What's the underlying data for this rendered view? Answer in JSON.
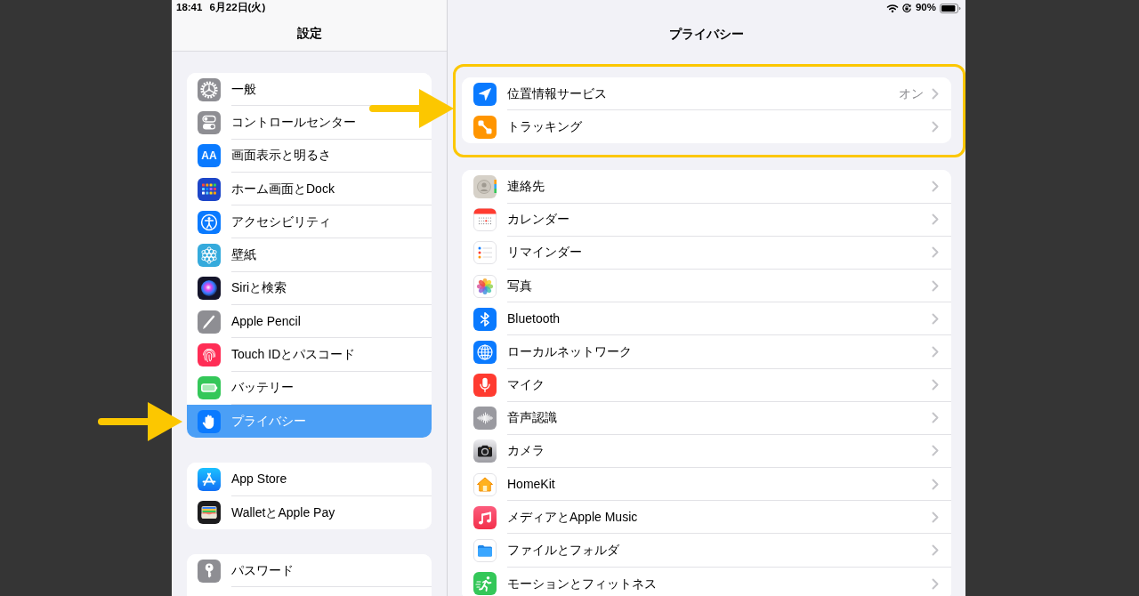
{
  "status_bar": {
    "time": "18:41",
    "date": "6月22日(火)",
    "battery": "90%"
  },
  "sidebar": {
    "title": "設定",
    "groups": [
      {
        "cut_off": false,
        "items": [
          {
            "label": "一般",
            "selected": false
          },
          {
            "label": "コントロールセンター",
            "selected": false
          },
          {
            "label": "画面表示と明るさ",
            "icon_text": "AA",
            "selected": false
          },
          {
            "label": "ホーム画面とDock",
            "selected": false
          },
          {
            "label": "アクセシビリティ",
            "selected": false
          },
          {
            "label": "壁紙",
            "selected": false
          },
          {
            "label": "Siriと検索",
            "selected": false
          },
          {
            "label": "Apple Pencil",
            "selected": false
          },
          {
            "label": "Touch IDとパスコード",
            "selected": false
          },
          {
            "label": "バッテリー",
            "selected": false
          },
          {
            "label": "プライバシー",
            "selected": true
          }
        ]
      },
      {
        "cut_off": false,
        "items": [
          {
            "label": "App Store",
            "selected": false
          },
          {
            "label": "WalletとApple Pay",
            "selected": false
          }
        ]
      },
      {
        "cut_off": true,
        "items": [
          {
            "label": "パスワード",
            "selected": false
          }
        ]
      }
    ]
  },
  "detail": {
    "title": "プライバシー",
    "groups": [
      {
        "highlighted": true,
        "items": [
          {
            "label": "位置情報サービス",
            "value": "オン"
          },
          {
            "label": "トラッキング"
          }
        ]
      },
      {
        "highlighted": false,
        "items": [
          {
            "label": "連絡先"
          },
          {
            "label": "カレンダー"
          },
          {
            "label": "リマインダー"
          },
          {
            "label": "写真"
          },
          {
            "label": "Bluetooth"
          },
          {
            "label": "ローカルネットワーク"
          },
          {
            "label": "マイク"
          },
          {
            "label": "音声認識"
          },
          {
            "label": "カメラ"
          },
          {
            "label": "HomeKit"
          },
          {
            "label": "メディアとApple Music"
          },
          {
            "label": "ファイルとフォルダ"
          },
          {
            "label": "モーションとフィットネス"
          }
        ]
      }
    ]
  }
}
